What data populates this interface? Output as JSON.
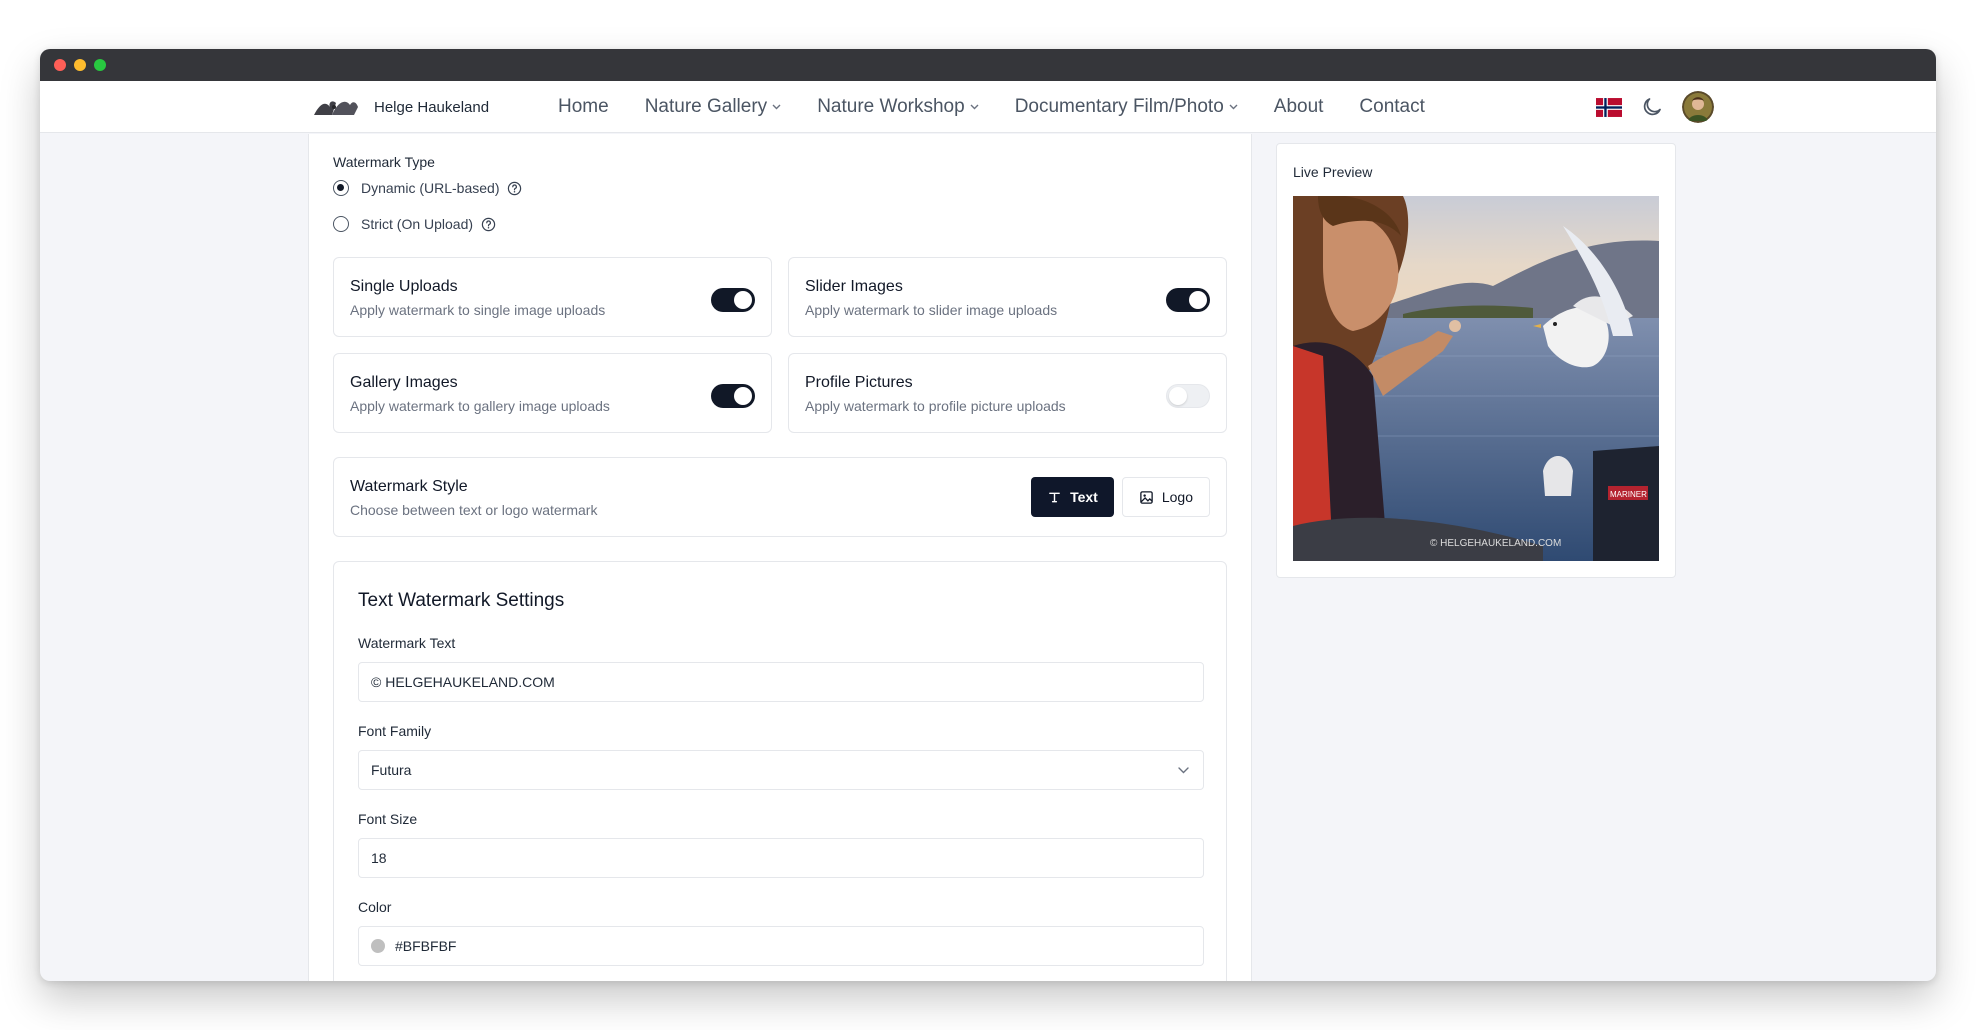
{
  "nav": {
    "brand": "Helge Haukeland",
    "items": [
      {
        "label": "Home",
        "dropdown": false
      },
      {
        "label": "Nature Gallery",
        "dropdown": true
      },
      {
        "label": "Nature Workshop",
        "dropdown": true
      },
      {
        "label": "Documentary Film/Photo",
        "dropdown": true
      },
      {
        "label": "About",
        "dropdown": false
      },
      {
        "label": "Contact",
        "dropdown": false
      }
    ],
    "icons": [
      "norway-flag-icon",
      "moon-icon",
      "avatar"
    ]
  },
  "watermark_type": {
    "label": "Watermark Type",
    "options": [
      {
        "label": "Dynamic (URL-based)",
        "checked": true
      },
      {
        "label": "Strict (On Upload)",
        "checked": false
      }
    ]
  },
  "toggles": {
    "single_uploads": {
      "title": "Single Uploads",
      "desc": "Apply watermark to single image uploads",
      "on": true
    },
    "slider_images": {
      "title": "Slider Images",
      "desc": "Apply watermark to slider image uploads",
      "on": true
    },
    "gallery_images": {
      "title": "Gallery Images",
      "desc": "Apply watermark to gallery image uploads",
      "on": true
    },
    "profile_pictures": {
      "title": "Profile Pictures",
      "desc": "Apply watermark to profile picture uploads",
      "on": false
    }
  },
  "style": {
    "title": "Watermark Style",
    "desc": "Choose between text or logo watermark",
    "text_label": "Text",
    "logo_label": "Logo",
    "selected": "Text"
  },
  "text_settings": {
    "title": "Text Watermark Settings",
    "text_label": "Watermark Text",
    "text_value": "© HELGEHAUKELAND.COM",
    "font_family_label": "Font Family",
    "font_family_value": "Futura",
    "font_size_label": "Font Size",
    "font_size_value": "18",
    "color_label": "Color",
    "color_value": "#BFBFBF"
  },
  "preview": {
    "label": "Live Preview",
    "watermark": "© HELGEHAUKELAND.COM",
    "boat_text": "MARINER"
  },
  "colors": {
    "accent": "#0f172a",
    "window_bar": "#35363a",
    "swatch": "#BFBFBF"
  }
}
